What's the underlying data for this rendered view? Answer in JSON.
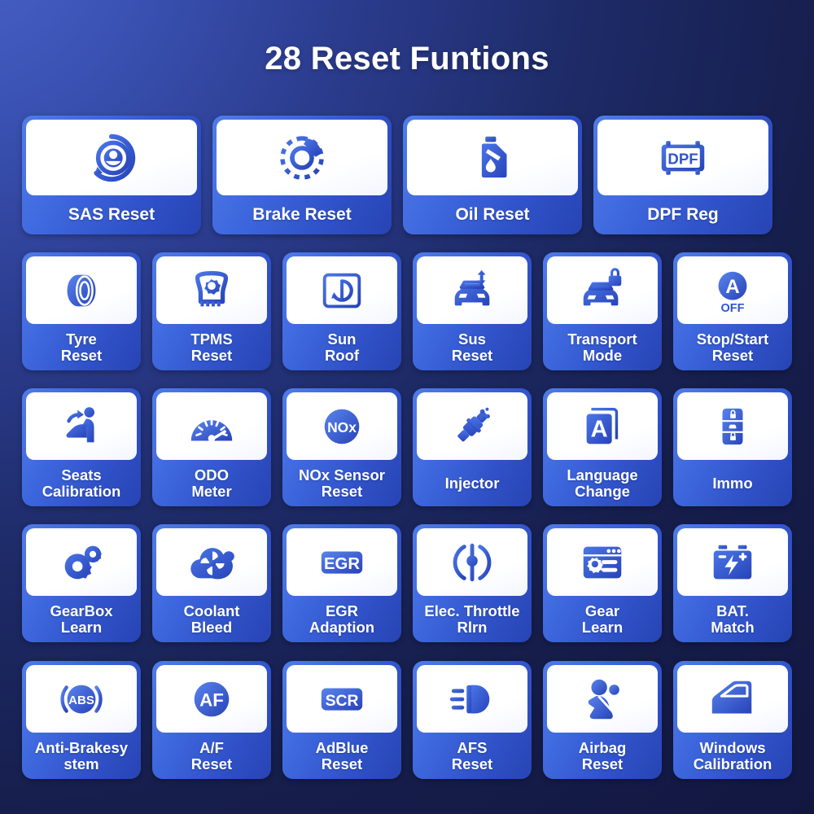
{
  "page": {
    "title": "28 Reset Funtions",
    "background_from": "#4a63c9",
    "background_to": "#121740",
    "card_color": "#3d66dd",
    "icon_color": "#2f55cf",
    "panel_color": "#ffffff",
    "text_color": "#ffffff"
  },
  "rows": [
    {
      "columns": 4,
      "cards": [
        {
          "label": "SAS Reset",
          "icon": "steering-wheel-reset-icon"
        },
        {
          "label": "Brake Reset",
          "icon": "brake-disc-caliper-icon"
        },
        {
          "label": "Oil Reset",
          "icon": "oil-can-drop-icon"
        },
        {
          "label": "DPF Reg",
          "icon": "dpf-filter-icon",
          "icon_text": "DPF"
        }
      ]
    },
    {
      "columns": 6,
      "cards": [
        {
          "label": "Tyre\nReset",
          "icon": "tyre-icon"
        },
        {
          "label": "TPMS\nReset",
          "icon": "tpms-tyre-gear-icon"
        },
        {
          "label": "Sun\nRoof",
          "icon": "sunroof-reset-icon"
        },
        {
          "label": "Sus\nReset",
          "icon": "suspension-car-arrows-icon"
        },
        {
          "label": "Transport\nMode",
          "icon": "car-lock-icon"
        },
        {
          "label": "Stop/Start\nReset",
          "icon": "auto-stop-start-icon",
          "icon_text": "A",
          "icon_subtext": "OFF"
        }
      ]
    },
    {
      "columns": 6,
      "cards": [
        {
          "label": "Seats\nCalibration",
          "icon": "car-seat-arrow-icon"
        },
        {
          "label": "ODO\nMeter",
          "icon": "odometer-gauge-icon"
        },
        {
          "label": "NOx Sensor\nReset",
          "icon": "nox-sensor-icon",
          "icon_text": "NOx"
        },
        {
          "label": "Injector",
          "icon": "fuel-injector-icon"
        },
        {
          "label": "Language\nChange",
          "icon": "language-book-icon",
          "icon_text": "A"
        },
        {
          "label": "Immo",
          "icon": "car-key-fob-icon"
        }
      ]
    },
    {
      "columns": 6,
      "cards": [
        {
          "label": "GearBox\nLearn",
          "icon": "gears-icon"
        },
        {
          "label": "Coolant\nBleed",
          "icon": "coolant-fan-icon"
        },
        {
          "label": "EGR\nAdaption",
          "icon": "egr-valve-icon",
          "icon_text": "EGR"
        },
        {
          "label": "Elec. Throttle\nRlrn",
          "icon": "electronic-throttle-icon"
        },
        {
          "label": "Gear\nLearn",
          "icon": "gear-learn-screen-icon"
        },
        {
          "label": "BAT.\nMatch",
          "icon": "battery-match-icon"
        }
      ]
    },
    {
      "columns": 6,
      "cards": [
        {
          "label": "Anti-Brakesy\nstem",
          "icon": "abs-icon",
          "icon_text": "ABS"
        },
        {
          "label": "A/F\nReset",
          "icon": "air-fuel-ratio-icon",
          "icon_text": "AF"
        },
        {
          "label": "AdBlue\nReset",
          "icon": "scr-adblue-icon",
          "icon_text": "SCR"
        },
        {
          "label": "AFS\nReset",
          "icon": "headlight-afs-icon"
        },
        {
          "label": "Airbag\nReset",
          "icon": "airbag-seatbelt-icon"
        },
        {
          "label": "Windows\nCalibration",
          "icon": "car-door-window-icon"
        }
      ]
    }
  ]
}
